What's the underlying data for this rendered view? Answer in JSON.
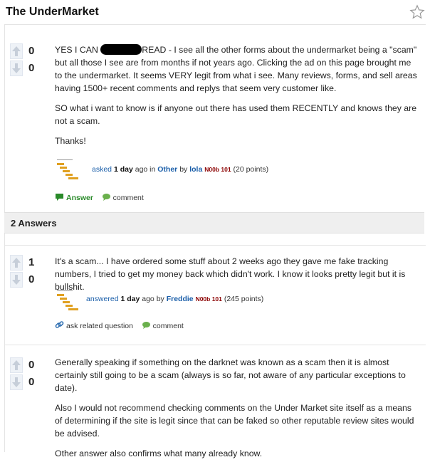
{
  "question": {
    "title": "The UnderMarket",
    "votes_up": "0",
    "votes_down": "0",
    "line1_pre": "YES I CAN",
    "line1_post": "READ - I see all the other forms about the undermarket being a \"scam\" but all those I see are from months if not years ago. Clicking the ad on this page brought me to the undermarket. It seems VERY legit from what i see. Many reviews, forms, and sell areas having 1500+ recent comments and replys that seem very customer like.",
    "para2": "SO what i want to know is if anyone out there has used them RECENTLY and knows they are not a scam.",
    "para3": "Thanks!",
    "meta": {
      "verb": "asked",
      "when": "1 day",
      "ago": "ago in",
      "category": "Other",
      "by": "by",
      "user": "lola",
      "level": "N00b 101",
      "points": "(20 points)"
    },
    "answer_label": "Answer",
    "comment_label": "comment"
  },
  "answers_header": "2 Answers",
  "answers": [
    {
      "votes_up": "1",
      "votes_down": "0",
      "paragraphs": [
        "It's a scam... I have ordered some stuff about 2 weeks ago they gave me fake tracking numbers, I tried to get my money back which didn't work. I know it looks pretty legit but it is bullshit."
      ],
      "meta": {
        "verb": "answered",
        "when": "1 day",
        "ago": "ago",
        "by": "by",
        "user": "Freddie",
        "level": "N00b 101",
        "points": "(245 points)"
      },
      "related_label": "ask related question",
      "comment_label": "comment"
    },
    {
      "votes_up": "0",
      "votes_down": "0",
      "paragraphs": [
        "Generally speaking if something on the darknet was known as a scam then it is almost certainly still going to be a scam (always is so far, not aware of any particular exceptions to date).",
        "Also I would not recommend checking comments on the Under Market site itself as a means of determining if the site is legit since that can be faked so other reputable review sites would be advised.",
        "Other answer also confirms what many already know."
      ]
    }
  ]
}
